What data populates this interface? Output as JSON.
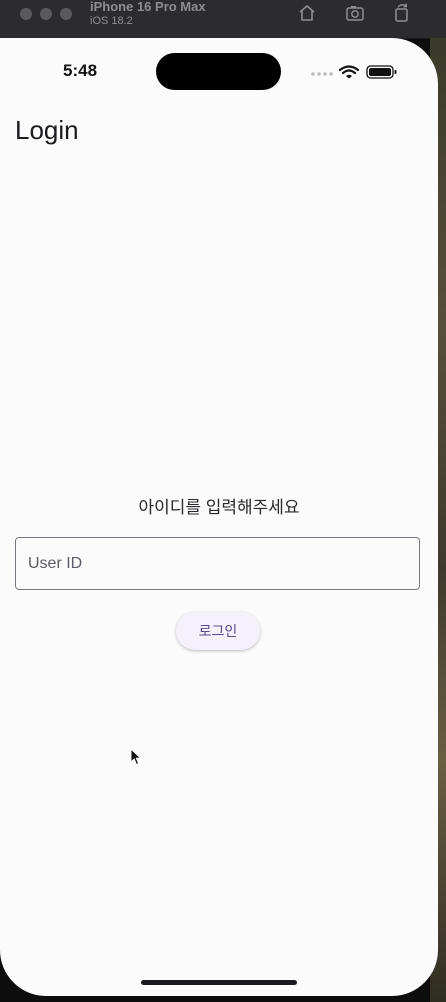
{
  "simulator": {
    "device_name": "iPhone 16 Pro Max",
    "os_version": "iOS 18.2",
    "icons": [
      "home-icon",
      "screenshot-icon",
      "rotate-icon"
    ]
  },
  "status_bar": {
    "time": "5:48",
    "icons": [
      "cellular-icon",
      "wifi-icon",
      "battery-icon"
    ]
  },
  "app_bar": {
    "title": "Login"
  },
  "login_form": {
    "prompt": "아이디를 입력해주세요",
    "user_id_placeholder": "User ID",
    "user_id_value": "",
    "login_button_label": "로그인"
  },
  "colors": {
    "background": "#fbfbfb",
    "button_bg": "#f5f1fb",
    "button_text": "#5a4a8a",
    "field_border": "#7a7680"
  }
}
